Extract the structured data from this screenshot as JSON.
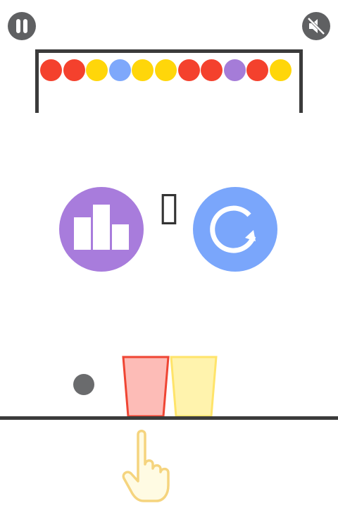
{
  "hud": {
    "pause_icon": "pause-icon",
    "sound_icon": "sound-muted-icon",
    "button_color": "#5f6062"
  },
  "ball_queue": {
    "balls": [
      {
        "color": "red",
        "hex": "#f4412d"
      },
      {
        "color": "red",
        "hex": "#f4412d"
      },
      {
        "color": "yellow",
        "hex": "#ffd60a"
      },
      {
        "color": "blue",
        "hex": "#7ea8fb"
      },
      {
        "color": "yellow",
        "hex": "#ffd60a"
      },
      {
        "color": "yellow",
        "hex": "#ffd60a"
      },
      {
        "color": "red",
        "hex": "#f4412d"
      },
      {
        "color": "red",
        "hex": "#f4412d"
      },
      {
        "color": "purple",
        "hex": "#a57cd8"
      },
      {
        "color": "red",
        "hex": "#f4412d"
      },
      {
        "color": "yellow",
        "hex": "#ffd60a"
      }
    ]
  },
  "score": {
    "value": "▯"
  },
  "menu": {
    "leaderboard_icon": "podium-icon",
    "leaderboard_color": "#a87cdc",
    "restart_icon": "restart-icon",
    "restart_color": "#7aa6fb"
  },
  "play_area": {
    "current_ball_color": "#6a6b6d",
    "cups": [
      {
        "color": "red",
        "fill": "#fdbcb7",
        "stroke": "#ef4533"
      },
      {
        "color": "yellow",
        "fill": "#fff3ad",
        "stroke": "#ffe46a"
      }
    ],
    "hint_icon": "tap-hand-icon"
  }
}
